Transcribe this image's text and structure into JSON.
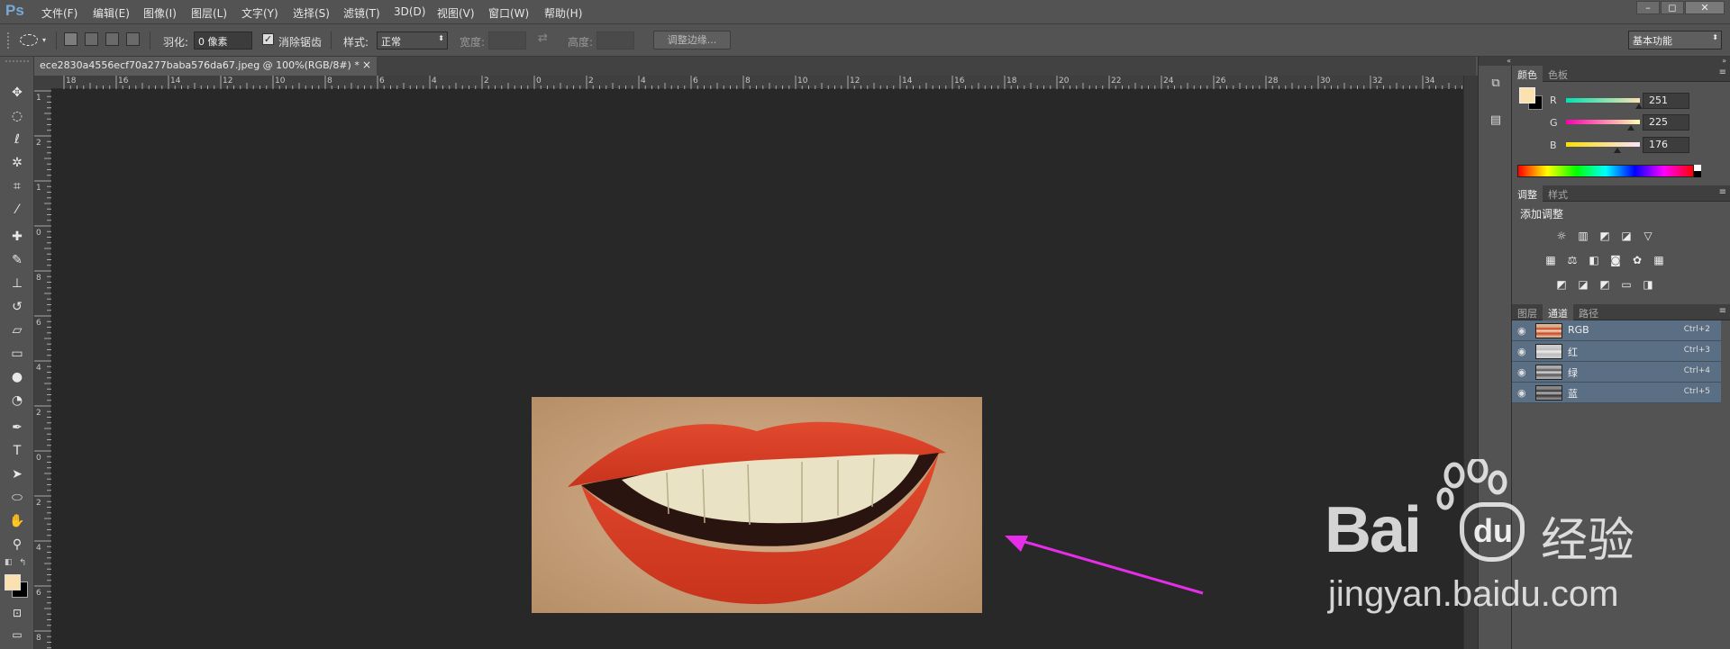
{
  "app": {
    "logo": "Ps"
  },
  "menu": [
    "文件(F)",
    "编辑(E)",
    "图像(I)",
    "图层(L)",
    "文字(Y)",
    "选择(S)",
    "滤镜(T)",
    "3D(D)",
    "视图(V)",
    "窗口(W)",
    "帮助(H)"
  ],
  "window_controls": [
    "–",
    "◻",
    "✕"
  ],
  "options": {
    "feather_label": "羽化:",
    "feather_value": "0 像素",
    "antialias_label": "消除锯齿",
    "style_label": "样式:",
    "style_value": "正常",
    "width_label": "宽度:",
    "height_label": "高度:",
    "refine_edge_label": "调整边缘...",
    "workspace_value": "基本功能"
  },
  "document": {
    "tab_title": "ece2830a4556ecf70a277baba576da67.jpeg @ 100%(RGB/8#) *",
    "close": "×"
  },
  "rulers": {
    "h_labels": [
      "18",
      "16",
      "14",
      "12",
      "10",
      "8",
      "6",
      "4",
      "2",
      "0",
      "2",
      "4",
      "6",
      "8",
      "10",
      "12",
      "14",
      "16",
      "18",
      "20",
      "22",
      "24",
      "26",
      "28",
      "30",
      "32",
      "34",
      "36"
    ],
    "v_labels": [
      "1",
      "2",
      "1",
      "0",
      "8",
      "6",
      "4",
      "2",
      "0",
      "2",
      "4",
      "6",
      "8"
    ]
  },
  "color_panel": {
    "tabs": [
      "颜色",
      "色板"
    ],
    "channels": [
      {
        "label": "R",
        "value": "251",
        "level": 0.984
      },
      {
        "label": "G",
        "value": "225",
        "level": 0.882
      },
      {
        "label": "B",
        "value": "176",
        "level": 0.69
      }
    ],
    "foreground": "#fbe1b0",
    "background": "#000000"
  },
  "adjustments_panel": {
    "tabs": [
      "调整",
      "样式"
    ],
    "title": "添加调整",
    "icons_row1": [
      "brightness-icon",
      "levels-icon",
      "curves-icon",
      "exposure-icon",
      "vibrance-icon"
    ],
    "icons_row2": [
      "hue-saturation-icon",
      "color-balance-icon",
      "black-white-icon",
      "photo-filter-icon",
      "channel-mixer-icon",
      "color-lookup-icon"
    ],
    "icons_row3": [
      "invert-icon",
      "posterize-icon",
      "threshold-icon",
      "gradient-map-icon",
      "selective-color-icon"
    ]
  },
  "channels_panel": {
    "tabs": [
      "图层",
      "通道",
      "路径"
    ],
    "rows": [
      {
        "name": "RGB",
        "shortcut": "Ctrl+2"
      },
      {
        "name": "红",
        "shortcut": "Ctrl+3"
      },
      {
        "name": "绿",
        "shortcut": "Ctrl+4"
      },
      {
        "name": "蓝",
        "shortcut": "Ctrl+5"
      }
    ]
  },
  "watermark": {
    "brand": "Bai",
    "brand2": "经验",
    "url": "jingyan.baidu.com"
  },
  "colors": {
    "arrow": "#e62ee8",
    "accent_row": "#5a6e84"
  }
}
